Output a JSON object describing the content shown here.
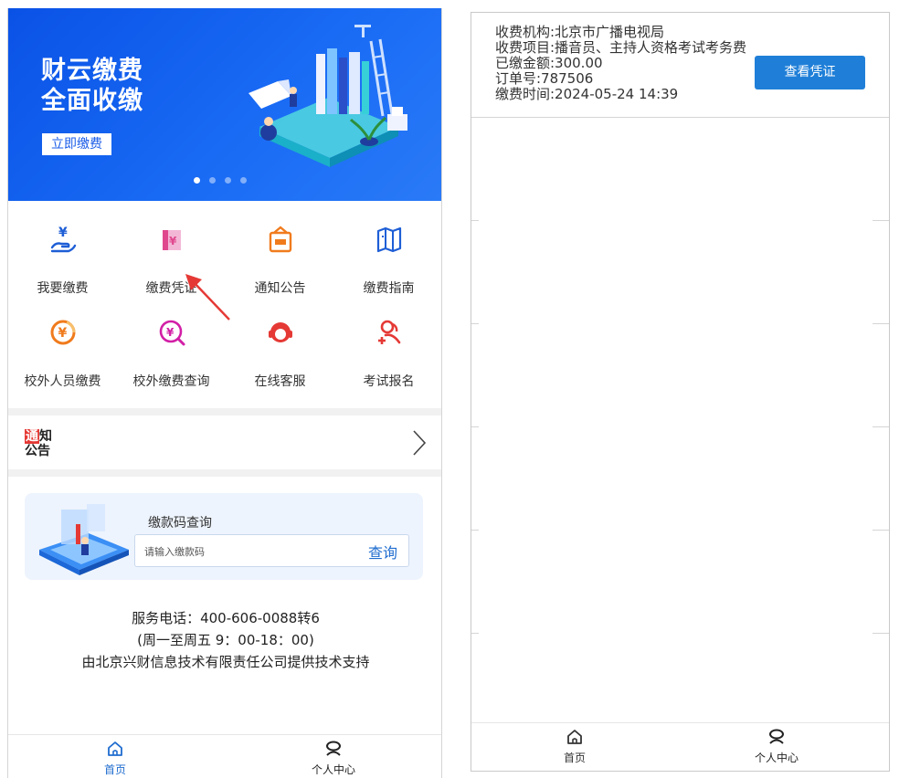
{
  "colors": {
    "brand_blue": "#1a6cf5",
    "active_tab": "#1f6ccf",
    "voucher_button": "#1f7fd8",
    "arrow_red": "#e53935",
    "icon_blue": "#1e5ed6",
    "icon_pink": "#e0488e",
    "icon_orange": "#f07b1d",
    "icon_magenta": "#d21fa6",
    "icon_red": "#e53935"
  },
  "left": {
    "banner": {
      "title_line1": "财云缴费",
      "title_line2": "全面收缴",
      "button_label": "立即缴费"
    },
    "grid": [
      {
        "label": "我要缴费",
        "icon": "hand-yuan-icon"
      },
      {
        "label": "缴费凭证",
        "icon": "voucher-icon"
      },
      {
        "label": "通知公告",
        "icon": "notice-icon"
      },
      {
        "label": "缴费指南",
        "icon": "guide-book-icon"
      },
      {
        "label": "校外人员缴费",
        "icon": "yuan-circle-icon"
      },
      {
        "label": "校外缴费查询",
        "icon": "yuan-search-icon"
      },
      {
        "label": "在线客服",
        "icon": "customer-service-icon"
      },
      {
        "label": "考试报名",
        "icon": "add-user-icon"
      }
    ],
    "notice": {
      "line1_highlight": "通",
      "line1_rest": "知",
      "line2": "公告"
    },
    "code_query": {
      "title": "缴款码查询",
      "placeholder": "请输入缴款码",
      "button_label": "查询"
    },
    "service": {
      "phone": "服务电话：400-606-0088转6",
      "hours": "(周一至周五 9：00-18：00)",
      "support": "由北京兴财信息技术有限责任公司提供技术支持"
    },
    "tabs": [
      {
        "label": "首页",
        "icon": "home-icon",
        "active": true
      },
      {
        "label": "个人中心",
        "icon": "profile-icon",
        "active": false
      }
    ]
  },
  "right": {
    "record": {
      "org": "收费机构:北京市广播电视局",
      "item": "收费项目:播音员、主持人资格考试考务费",
      "amount": "已缴金额:300.00",
      "order": "订单号:787506",
      "time": "缴费时间:2024-05-24 14:39",
      "button_label": "查看凭证"
    },
    "tabs": [
      {
        "label": "首页",
        "icon": "home-icon"
      },
      {
        "label": "个人中心",
        "icon": "profile-icon"
      }
    ]
  }
}
